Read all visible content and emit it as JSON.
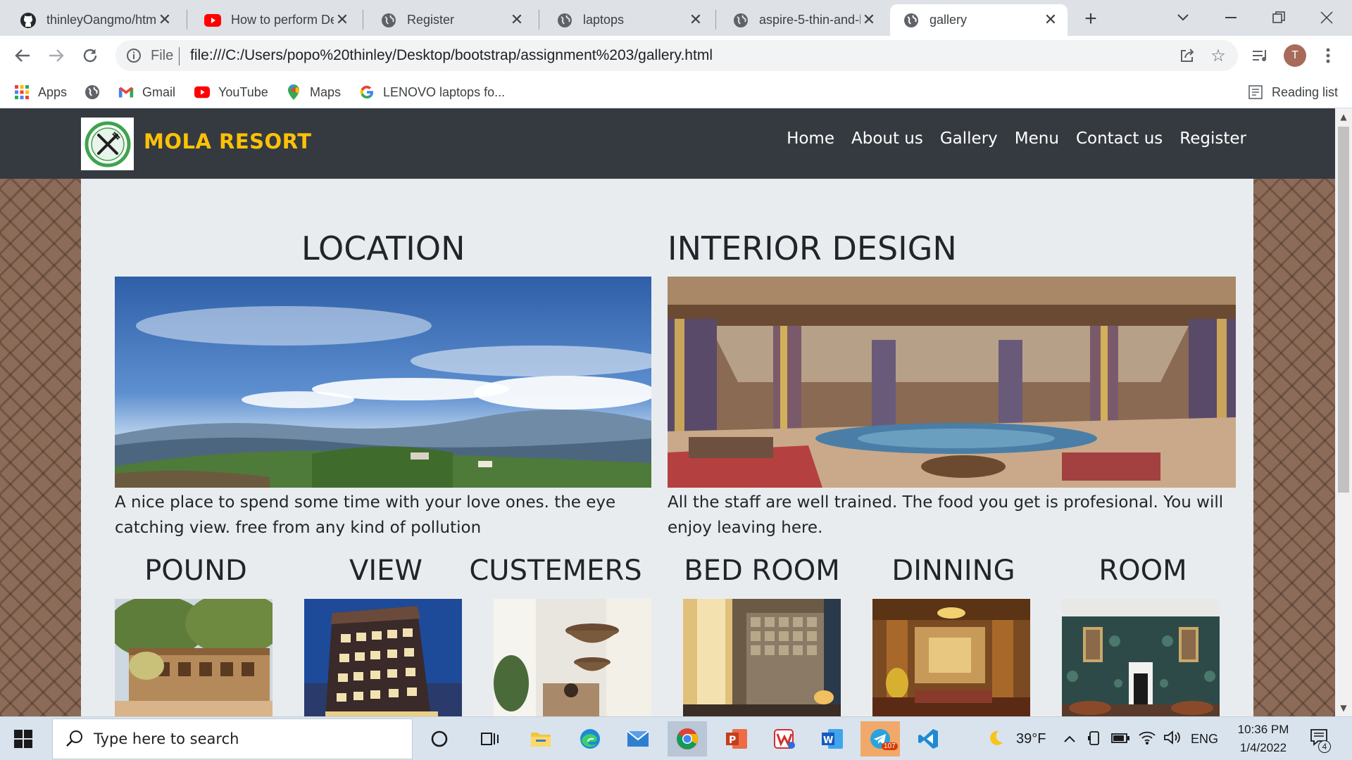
{
  "tabs": [
    {
      "title": "thinleyOangmo/htm",
      "icon": "github-icon"
    },
    {
      "title": "How to perform De",
      "icon": "youtube-icon"
    },
    {
      "title": "Register",
      "icon": "globe-icon"
    },
    {
      "title": "laptops",
      "icon": "globe-icon"
    },
    {
      "title": "aspire-5-thin-and-li",
      "icon": "globe-icon"
    },
    {
      "title": "gallery",
      "icon": "globe-icon",
      "active": true
    }
  ],
  "omnibox": {
    "scheme": "File",
    "url": "file:///C:/Users/popo%20thinley/Desktop/bootstrap/assignment%203/gallery.html"
  },
  "profile_initial": "T",
  "bookmarks": [
    {
      "label": "Apps",
      "icon": "apps-grid-icon"
    },
    {
      "label": "",
      "icon": "globe-icon"
    },
    {
      "label": "Gmail",
      "icon": "gmail-icon"
    },
    {
      "label": "YouTube",
      "icon": "youtube-icon"
    },
    {
      "label": "Maps",
      "icon": "maps-pin-icon"
    },
    {
      "label": "LENOVO laptops fo...",
      "icon": "google-icon"
    }
  ],
  "reading_list": "Reading list",
  "site": {
    "brand": "MOLA RESORT",
    "brand_color": "#ffc107",
    "nav": [
      "Home",
      "About us",
      "Gallery",
      "Menu",
      "Contact us",
      "Register"
    ],
    "featured": [
      {
        "title": "LOCATION",
        "description": "A nice place to spend some time with your love ones. the eye catching view. free from any kind of pollution"
      },
      {
        "title": "INTERIOR DESIGN",
        "description": "All the staff are well trained. The food you get is profesional. You will enjoy leaving here."
      }
    ],
    "gallery": [
      "POUND",
      "VIEW",
      "CUSTEMERS",
      "BED ROOM",
      "DINNING",
      "ROOM"
    ]
  },
  "taskbar": {
    "search_placeholder": "Type here to search",
    "weather": "39°F",
    "language": "ENG",
    "time": "10:36 PM",
    "date": "1/4/2022",
    "notifications": "4",
    "telegram_badge": "107"
  }
}
